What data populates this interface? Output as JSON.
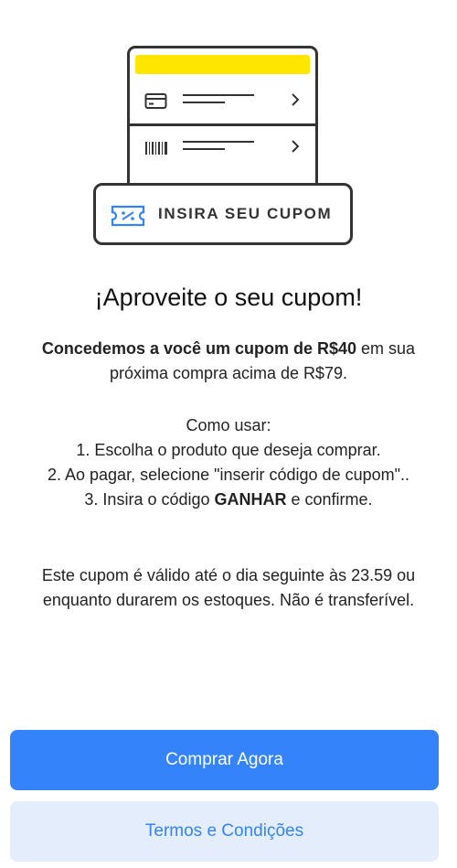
{
  "illustration": {
    "coupon_label": "INSIRA SEU CUPOM",
    "accent_yellow": "#ffe600",
    "icons": [
      "card-icon",
      "barcode-icon",
      "chevron-right-icon",
      "ticket-icon"
    ]
  },
  "title": "¡Aproveite o seu cupom!",
  "intro": {
    "bold": "Concedemos a você um cupom de R$40",
    "rest": " em sua próxima compra acima de R$79."
  },
  "how_to": {
    "heading": "Como usar:",
    "step1": "1. Escolha o produto que deseja comprar.",
    "step2": "2. Ao pagar, selecione \"inserir código de cupom\"..",
    "step3_before": "3. Insira o código ",
    "step3_code": "GANHAR",
    "step3_after": " e confirme."
  },
  "validity": "Este cupom é válido até o dia seguinte às 23.59 ou enquanto durarem os estoques. Não é transferível.",
  "buttons": {
    "primary": "Comprar Agora",
    "secondary": "Termos e Condições",
    "primary_color": "#3483fa",
    "secondary_bg": "#e3edfb"
  }
}
